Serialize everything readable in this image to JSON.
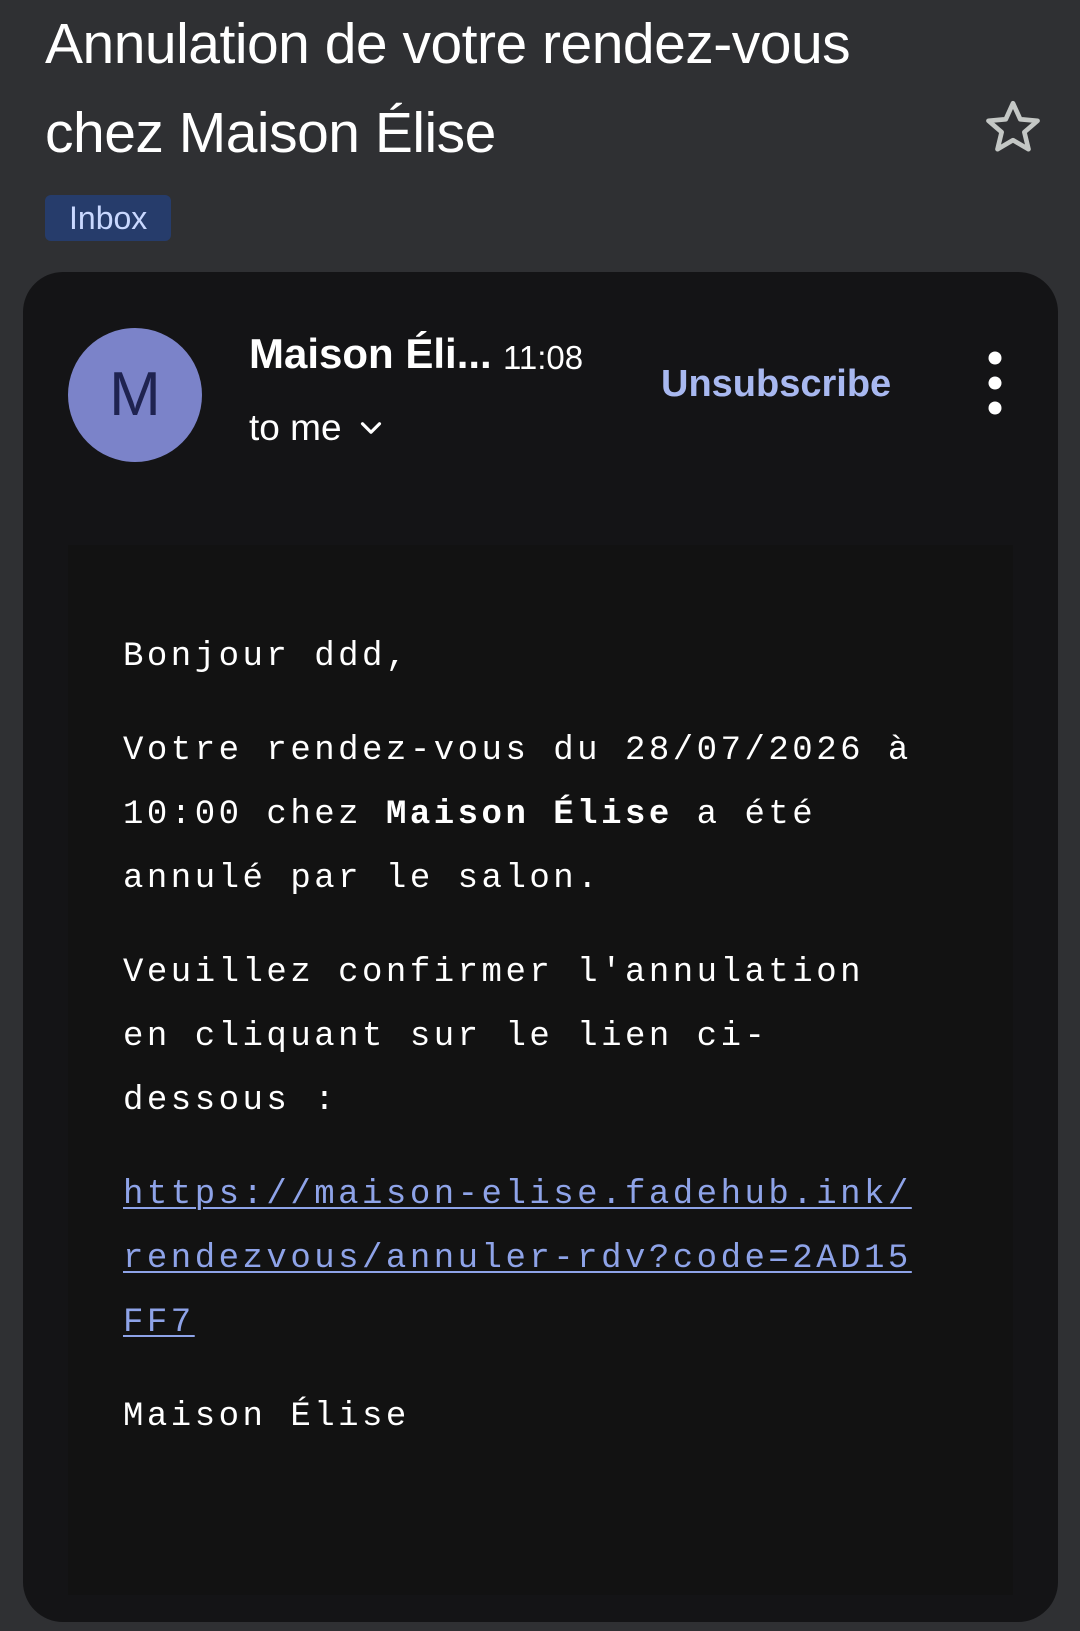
{
  "email": {
    "subject": "Annulation de votre rendez-vous chez Maison Élise",
    "label": "Inbox",
    "colors": {
      "background": "#2f3033",
      "card": "#141416",
      "avatar": "#7b83c9",
      "label_chip": "#263c6b",
      "link": "#8ea3e8"
    }
  },
  "message": {
    "avatar_letter": "M",
    "sender_name": "Maison Éli...",
    "time": "11:08",
    "recipient": "to me",
    "unsubscribe_label": "Unsubscribe",
    "icons": {
      "star": "star-outline-icon",
      "more": "more-vert-icon",
      "expand": "chevron-down-icon"
    }
  },
  "body": {
    "greeting": "Bonjour ddd,",
    "p1_before": "Votre rendez-vous du 28/07/2026 à 10:00 chez ",
    "p1_bold": "Maison Élise",
    "p1_after": " a été annulé par le salon.",
    "p2": "Veuillez confirmer l'annulation en cliquant sur le lien ci-dessous :",
    "link": "https://maison-elise.fadehub.ink/rendezvous/annuler-rdv?code=2AD15FF7",
    "signature": "Maison Élise"
  }
}
